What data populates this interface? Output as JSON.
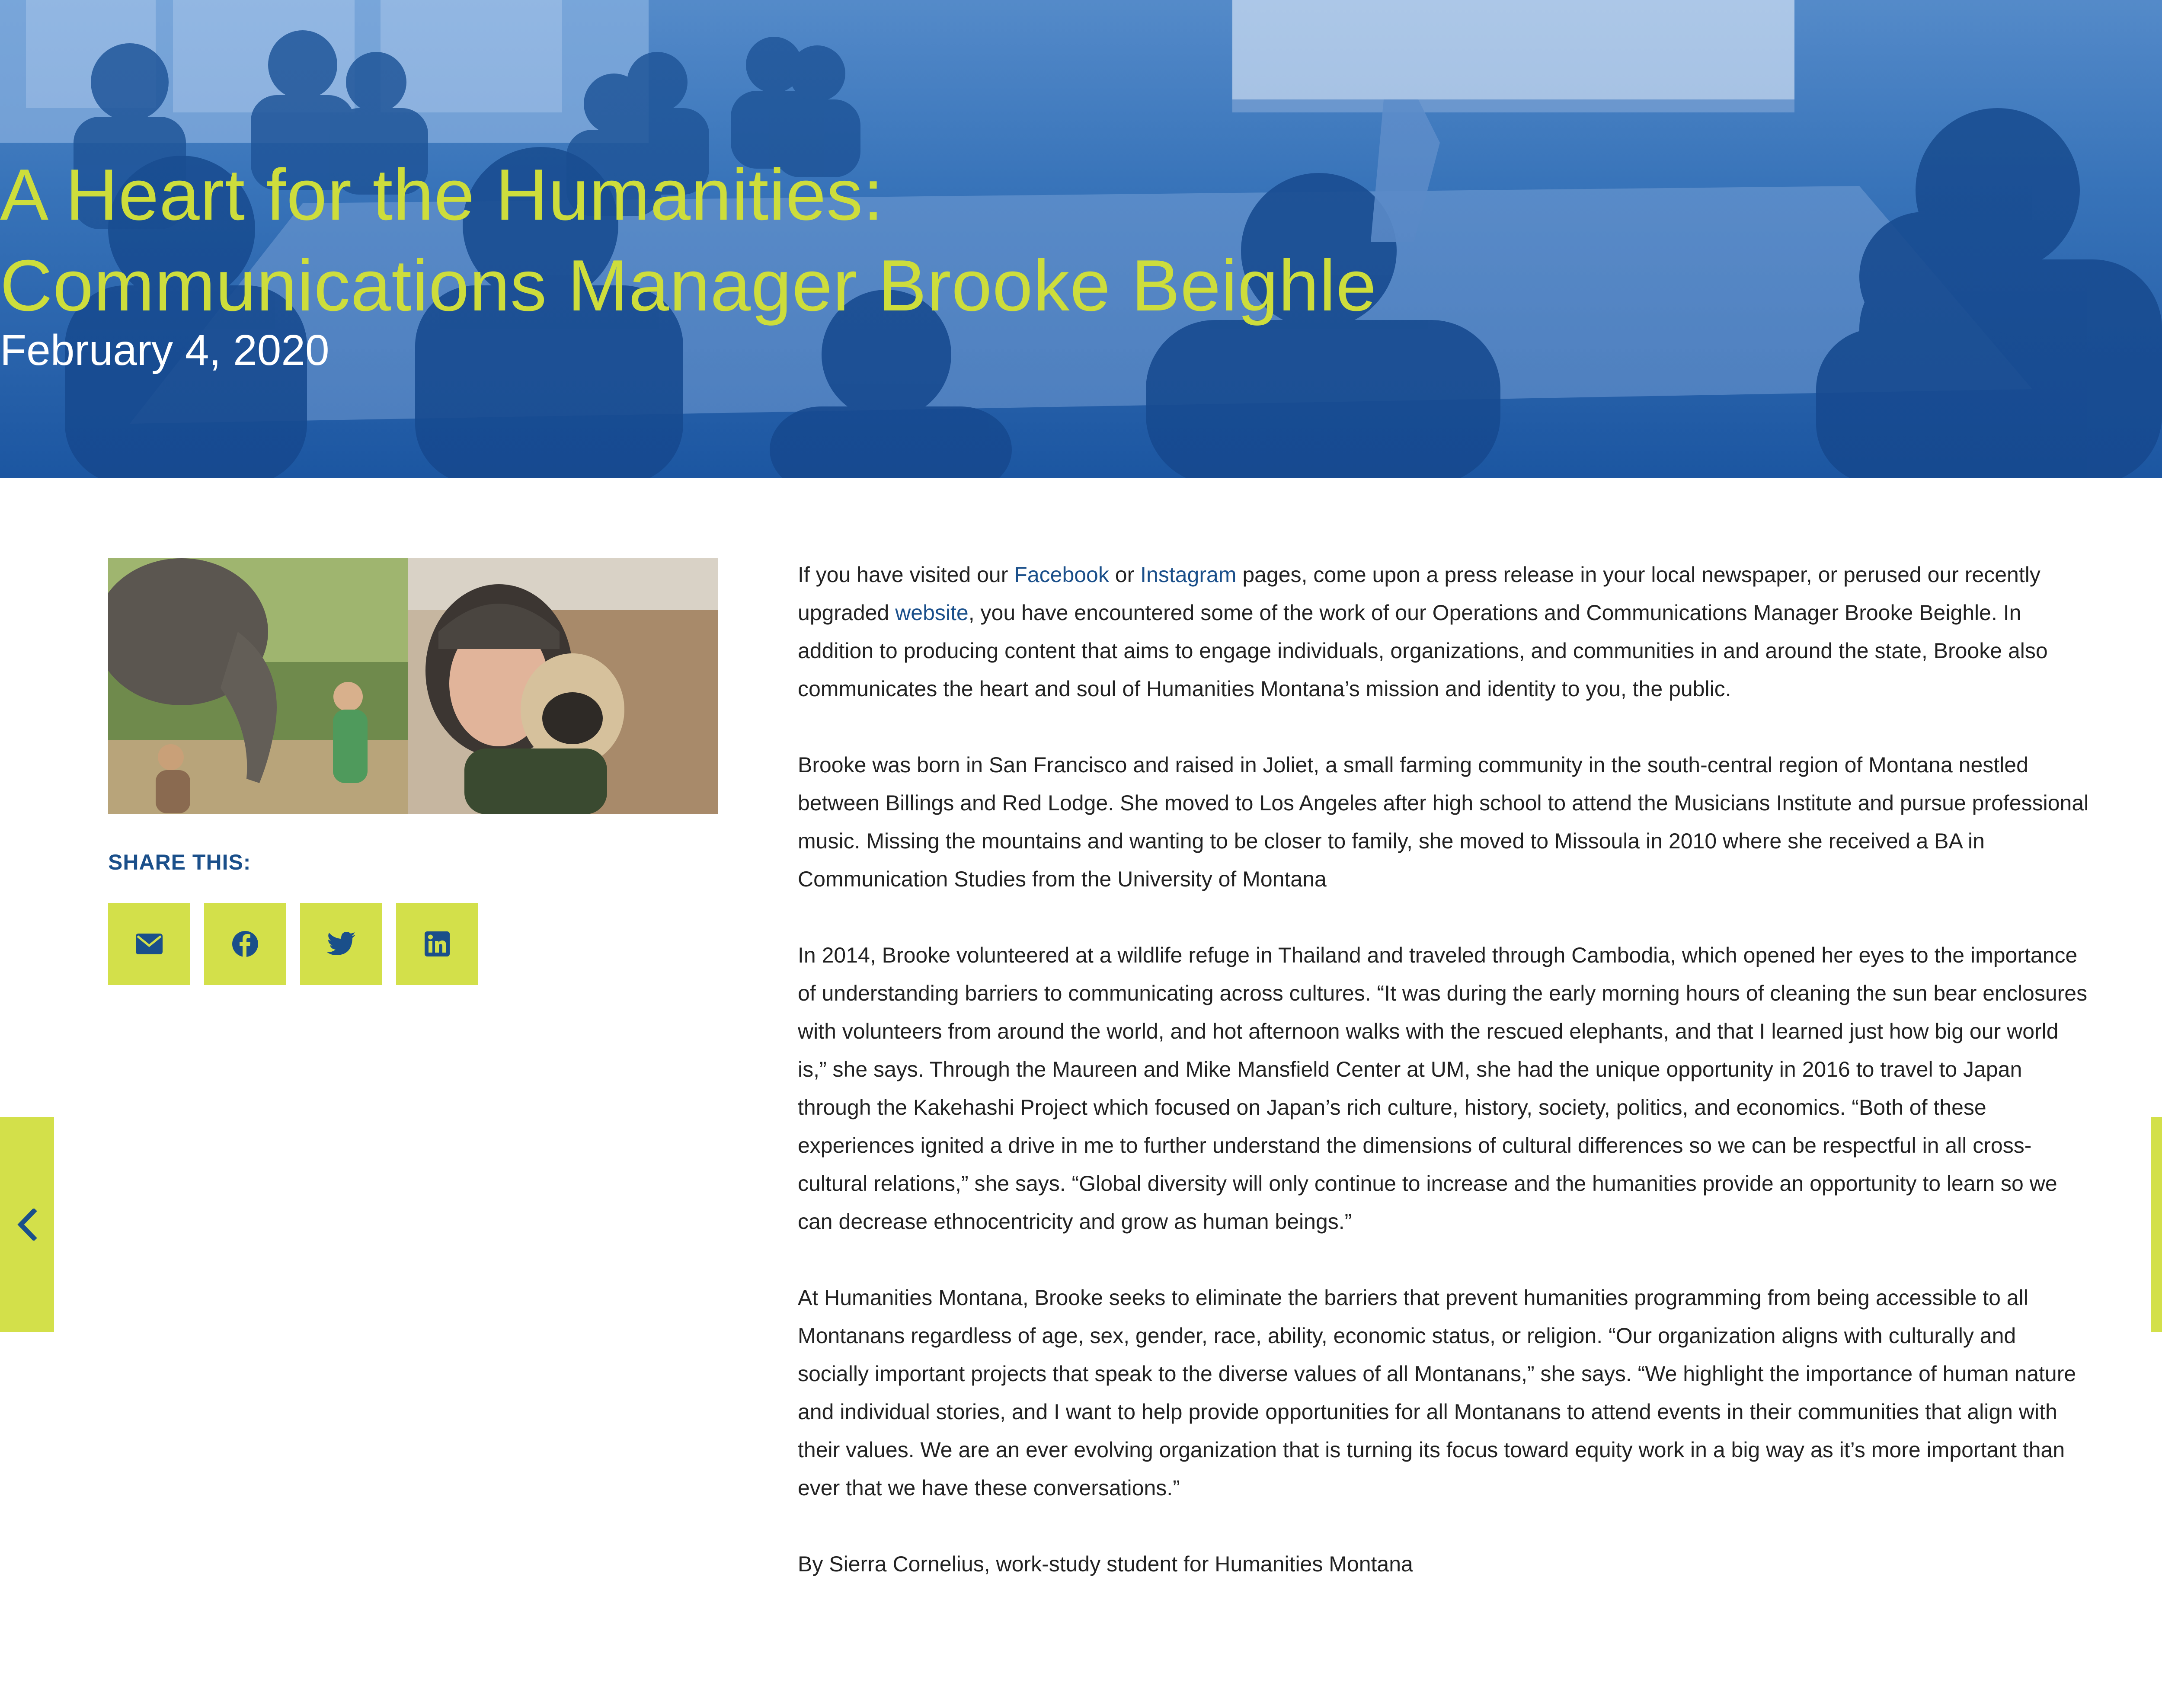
{
  "hero": {
    "title_line1": "A Heart for the Humanities:",
    "title_line2": "Communications Manager Brooke Beighle",
    "date": "February 4, 2020"
  },
  "share": {
    "label": "SHARE THIS:",
    "buttons": [
      {
        "icon": "email-icon"
      },
      {
        "icon": "facebook-icon"
      },
      {
        "icon": "twitter-icon"
      },
      {
        "icon": "linkedin-icon"
      }
    ]
  },
  "article": {
    "p1": {
      "t1": "If you have visited our ",
      "link1": "Facebook",
      "t2": " or ",
      "link2": "Instagram",
      "t3": " pages, come upon a press release in your local newspaper, or perused our recently upgraded ",
      "link3": "website",
      "t4": ", you have encountered some of the work of our Operations and Communications Manager Brooke Beighle. In addition to producing content that aims to engage individuals, organizations, and communities in and around the state, Brooke also communicates the heart and soul of Humanities Montana’s mission and identity to you, the public."
    },
    "p2": "Brooke was born in San Francisco and raised in Joliet, a small farming community in the south-central region of Montana nestled between Billings and Red Lodge. She moved to Los Angeles after high school to attend the Musicians Institute and pursue professional music. Missing the mountains and wanting to be closer to family, she moved to Missoula in 2010 where she received a BA in Communication Studies from the University of Montana",
    "p3": "In 2014, Brooke volunteered at a wildlife refuge in Thailand and traveled through Cambodia, which opened her eyes to the importance of understanding barriers to communicating across cultures. “It was during the early morning hours of cleaning the sun bear enclosures with volunteers from around the world, and hot afternoon walks with the rescued elephants, and that I learned just how big our world is,” she says. Through the Maureen and Mike Mansfield Center at UM, she had the unique opportunity in 2016 to travel to Japan through the Kakehashi Project which focused on Japan’s rich culture, history, society, politics, and economics. “Both of these experiences ignited a drive in me to further understand the dimensions of cultural differences so we can be respectful in all cross-cultural relations,” she says. “Global diversity will only continue to increase and the humanities provide an opportunity to learn so we can decrease ethnocentricity and grow as human beings.”",
    "p4": "At Humanities Montana, Brooke seeks to eliminate the barriers that prevent humanities programming from being accessible to all Montanans regardless of age, sex, gender, race, ability, economic status, or religion. “Our organization aligns with culturally and socially important projects that speak to the diverse values of all Montanans,” she says. “We highlight the importance of human nature and individual stories, and I want to help provide opportunities for all Montanans to attend events in their communities that align with their values. We are an ever evolving organization that is turning its focus toward equity work in a big way as it’s more important than ever that we have these conversations.”",
    "byline": "By Sierra Cornelius, work-study student for Humanities Montana"
  },
  "nav": {
    "prev_icon": "chevron-left-icon",
    "next_icon": "chevron-right-icon"
  },
  "colors": {
    "accent": "#d3e04a",
    "title": "#cddd3c",
    "link": "#1a4f8a",
    "hero_blue": "#2f6bb1",
    "text": "#222222"
  }
}
